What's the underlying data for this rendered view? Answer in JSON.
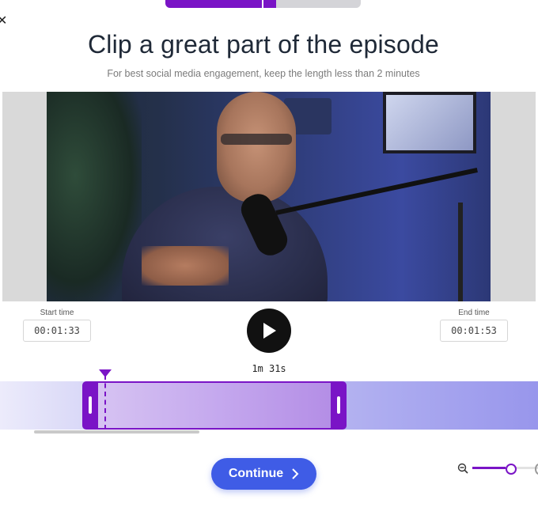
{
  "step_progress": {
    "completed_fraction": 0.565
  },
  "close": {
    "icon": "close-icon"
  },
  "header": {
    "title": "Clip a great part of the episode",
    "subtitle": "For best social media engagement, keep the length less than 2 minutes"
  },
  "video": {
    "description_icon": "video-preview"
  },
  "times": {
    "start_label": "Start time",
    "start_value": "00:01:33",
    "end_label": "End time",
    "end_value": "00:01:53"
  },
  "player": {
    "play_icon": "play-icon"
  },
  "playhead": {
    "time": "1m 31s"
  },
  "actions": {
    "continue_label": "Continue",
    "continue_icon": "chevron-right-icon"
  },
  "zoom": {
    "icon": "zoom-out-icon",
    "level_fraction": 0.5
  },
  "colors": {
    "accent": "#7a14c6",
    "primary_button": "#3f5ce6"
  }
}
